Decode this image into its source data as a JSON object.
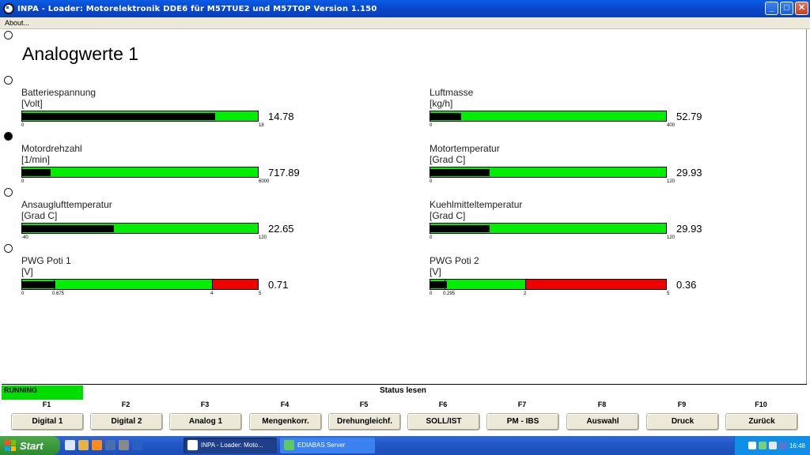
{
  "window": {
    "title": "INPA - Loader:  Motorelektronik DDE6 für M57TUE2 und M57TOP Version 1.150",
    "minimize": "_",
    "maximize": "□",
    "close": "✕"
  },
  "menu": {
    "about": "About..."
  },
  "page": {
    "heading": "Analogwerte 1"
  },
  "gauges": [
    {
      "label": "Batteriespannung",
      "unit": "[Volt]",
      "value": "14.78",
      "min": "0",
      "max": "18",
      "fill": 0.82
    },
    {
      "label": "Luftmasse",
      "unit": "[kg/h]",
      "value": "52.79",
      "min": "0",
      "max": "400",
      "fill": 0.13
    },
    {
      "label": "Motordrehzahl",
      "unit": "[1/min]",
      "value": "717.89",
      "min": "0",
      "max": "6000",
      "fill": 0.12
    },
    {
      "label": "Motortemperatur",
      "unit": "[Grad C]",
      "value": "29.93",
      "min": "0",
      "max": "120",
      "fill": 0.25
    },
    {
      "label": "Ansauglufttemperatur",
      "unit": "[Grad C]",
      "value": "22.65",
      "min": "-40",
      "max": "120",
      "fill": 0.39
    },
    {
      "label": "Kuehlmitteltemperatur",
      "unit": "[Grad C]",
      "value": "29.93",
      "min": "0",
      "max": "120",
      "fill": 0.25
    },
    {
      "label": "PWG Poti 1",
      "unit": "[V]",
      "value": "0.71",
      "min": "0",
      "max": "5",
      "lower": "0.675",
      "upper": "4",
      "fill": 0.142
    },
    {
      "label": "PWG Poti 2",
      "unit": "[V]",
      "value": "0.36",
      "min": "0",
      "max": "5",
      "lower": "0.295",
      "upper": "2",
      "fill": 0.072
    }
  ],
  "status": {
    "running": "RUNNING",
    "mode": "Status lesen"
  },
  "fkeys": [
    {
      "key": "F1",
      "label": "Digital 1"
    },
    {
      "key": "F2",
      "label": "Digital 2"
    },
    {
      "key": "F3",
      "label": "Analog 1"
    },
    {
      "key": "F4",
      "label": "Mengenkorr."
    },
    {
      "key": "F5",
      "label": "Drehungleichf."
    },
    {
      "key": "F6",
      "label": "SOLL/IST"
    },
    {
      "key": "F7",
      "label": "PM - IBS"
    },
    {
      "key": "F8",
      "label": "Auswahl"
    },
    {
      "key": "F9",
      "label": "Druck"
    },
    {
      "key": "F10",
      "label": "Zurück"
    }
  ],
  "taskbar": {
    "start": "Start",
    "tasks": [
      {
        "label": "INPA - Loader: Moto..."
      },
      {
        "label": "EDIABAS Server"
      }
    ],
    "clock": "16:48"
  },
  "colors": {
    "in_range": "#00ee00",
    "out_of_range": "#ee0000",
    "running": "#00dd00"
  }
}
